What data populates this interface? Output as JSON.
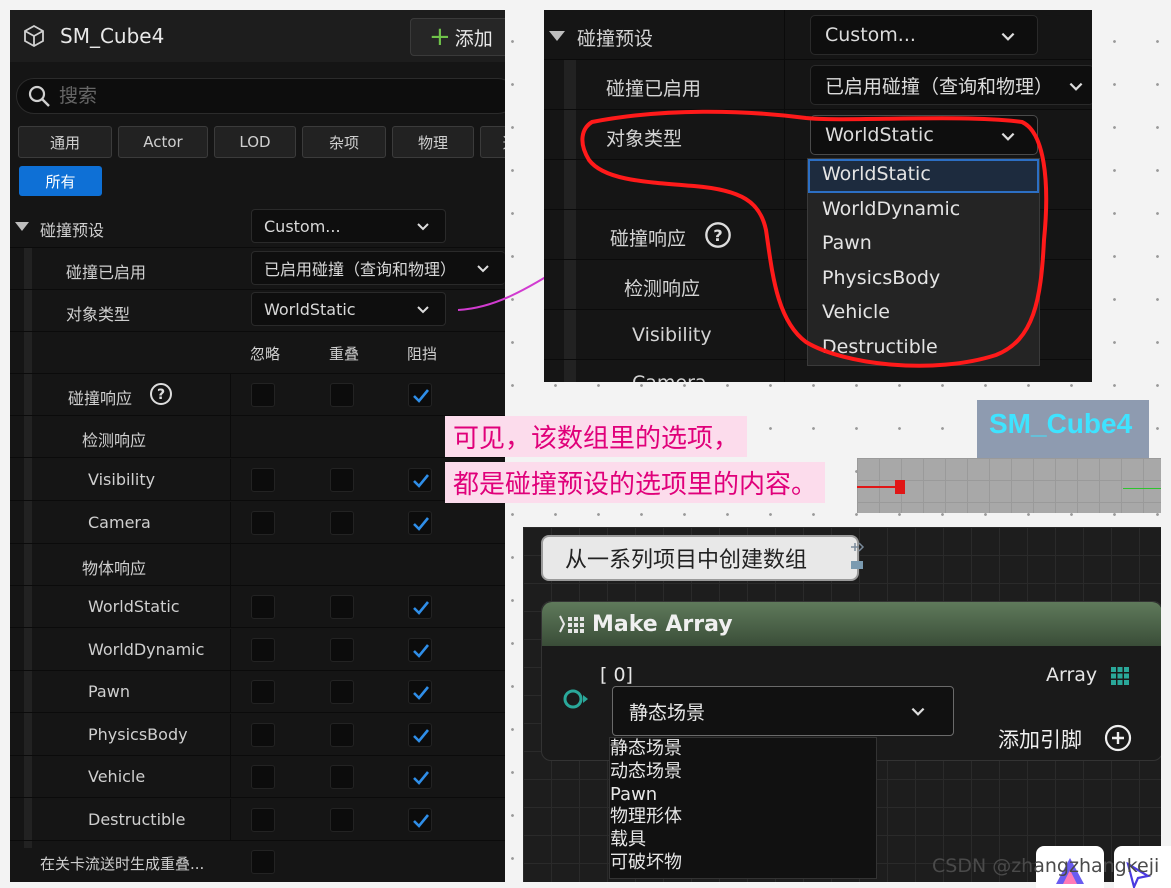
{
  "left_panel": {
    "title": "SM_Cube4",
    "add_button": "添加",
    "search_placeholder": "搜索",
    "filters": [
      "通用",
      "Actor",
      "LOD",
      "杂项",
      "物理",
      "选"
    ],
    "all_button": "所有",
    "collision_preset_label": "碰撞预设",
    "collision_preset_value": "Custom...",
    "collision_enabled_label": "碰撞已启用",
    "collision_enabled_value": "已启用碰撞（查询和物理）",
    "object_type_label": "对象类型",
    "object_type_value": "WorldStatic",
    "columns": [
      "忽略",
      "重叠",
      "阻挡"
    ],
    "collision_response_label": "碰撞响应",
    "trace_response_label": "检测响应",
    "trace_rows": [
      {
        "label": "Visibility",
        "ignore": false,
        "overlap": false,
        "block": true
      },
      {
        "label": "Camera",
        "ignore": false,
        "overlap": false,
        "block": true
      }
    ],
    "object_response_label": "物体响应",
    "object_rows": [
      {
        "label": "WorldStatic",
        "ignore": false,
        "overlap": false,
        "block": true
      },
      {
        "label": "WorldDynamic",
        "ignore": false,
        "overlap": false,
        "block": true
      },
      {
        "label": "Pawn",
        "ignore": false,
        "overlap": false,
        "block": true
      },
      {
        "label": "PhysicsBody",
        "ignore": false,
        "overlap": false,
        "block": true
      },
      {
        "label": "Vehicle",
        "ignore": false,
        "overlap": false,
        "block": true
      },
      {
        "label": "Destructible",
        "ignore": false,
        "overlap": false,
        "block": true
      }
    ],
    "overlap_on_stream_label": "在关卡流送时生成重叠...",
    "overlap_on_stream_checked": false
  },
  "right_panel": {
    "collision_preset_label": "碰撞预设",
    "collision_preset_value": "Custom...",
    "collision_enabled_label": "碰撞已启用",
    "collision_enabled_value": "已启用碰撞（查询和物理）",
    "object_type_label": "对象类型",
    "object_type_value": "WorldStatic",
    "collision_response_label": "碰撞响应",
    "trace_response_label": "检测响应",
    "visibility_label": "Visibility",
    "camera_label": "Camera",
    "dropdown_options": [
      "WorldStatic",
      "WorldDynamic",
      "Pawn",
      "PhysicsBody",
      "Vehicle",
      "Destructible"
    ]
  },
  "note": {
    "line1": "可见，该数组里的选项，",
    "line2": "都是碰撞预设的选项里的内容。"
  },
  "viewport": {
    "label": "SM_Cube4"
  },
  "blueprint": {
    "tooltip": "从一系列项目中创建数组",
    "node_title": "Make Array",
    "pin_label": "[ 0]",
    "output_label": "Array",
    "add_pin_label": "添加引脚",
    "selected_value": "静态场景",
    "options": [
      "静态场景",
      "动态场景",
      "Pawn",
      "物理形体",
      "载具",
      "可破坏物"
    ]
  },
  "watermark": "CSDN @zhangzhangkeji",
  "colors": {
    "accent_blue": "#0e70d6",
    "checkmark": "#2f8ee8",
    "annotation_red": "#ff1a1a",
    "arrow_magenta": "#d13bd0"
  }
}
